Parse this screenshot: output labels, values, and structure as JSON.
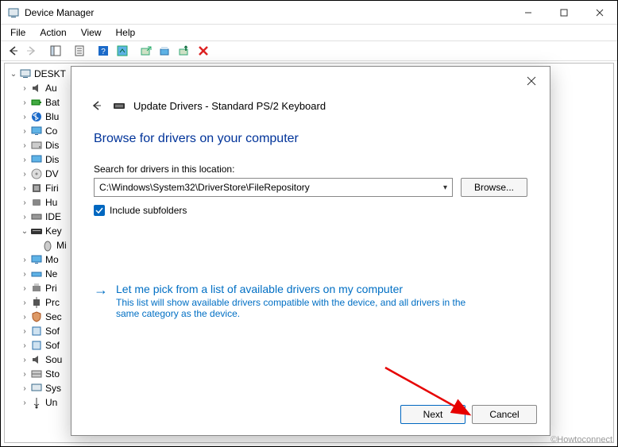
{
  "window": {
    "title": "Device Manager"
  },
  "titlebar_controls": {
    "minimize": "minimize",
    "maximize": "maximize",
    "close": "close"
  },
  "menubar": [
    "File",
    "Action",
    "View",
    "Help"
  ],
  "tree": {
    "root": "DESKT",
    "items": [
      {
        "label": "Au",
        "icon": "audio"
      },
      {
        "label": "Bat",
        "icon": "battery"
      },
      {
        "label": "Blu",
        "icon": "bluetooth"
      },
      {
        "label": "Co",
        "icon": "monitor"
      },
      {
        "label": "Dis",
        "icon": "disk"
      },
      {
        "label": "Dis",
        "icon": "display"
      },
      {
        "label": "DV",
        "icon": "dvd"
      },
      {
        "label": "Firi",
        "icon": "firmware"
      },
      {
        "label": "Hu",
        "icon": "hid"
      },
      {
        "label": "IDE",
        "icon": "ide"
      },
      {
        "label": "Key",
        "icon": "keyboard",
        "expanded": true
      },
      {
        "label": "Mi",
        "icon": "mouse",
        "child": true
      },
      {
        "label": "Mo",
        "icon": "monitor"
      },
      {
        "label": "Ne",
        "icon": "network"
      },
      {
        "label": "Pri",
        "icon": "printer"
      },
      {
        "label": "Prc",
        "icon": "processor"
      },
      {
        "label": "Sec",
        "icon": "security"
      },
      {
        "label": "Sof",
        "icon": "software"
      },
      {
        "label": "Sof",
        "icon": "software"
      },
      {
        "label": "Sou",
        "icon": "sound"
      },
      {
        "label": "Sto",
        "icon": "storage"
      },
      {
        "label": "Sys",
        "icon": "system"
      },
      {
        "label": "Un",
        "icon": "usb"
      }
    ]
  },
  "dialog": {
    "title": "Update Drivers - Standard PS/2 Keyboard",
    "heading": "Browse for drivers on your computer",
    "search_label": "Search for drivers in this location:",
    "path_value": "C:\\Windows\\System32\\DriverStore\\FileRepository",
    "browse_btn": "Browse...",
    "include_label": "Include subfolders",
    "pick_title": "Let me pick from a list of available drivers on my computer",
    "pick_desc": "This list will show available drivers compatible with the device, and all drivers in the same category as the device.",
    "next_btn": "Next",
    "cancel_btn": "Cancel"
  },
  "watermark": "©Howtoconnect"
}
